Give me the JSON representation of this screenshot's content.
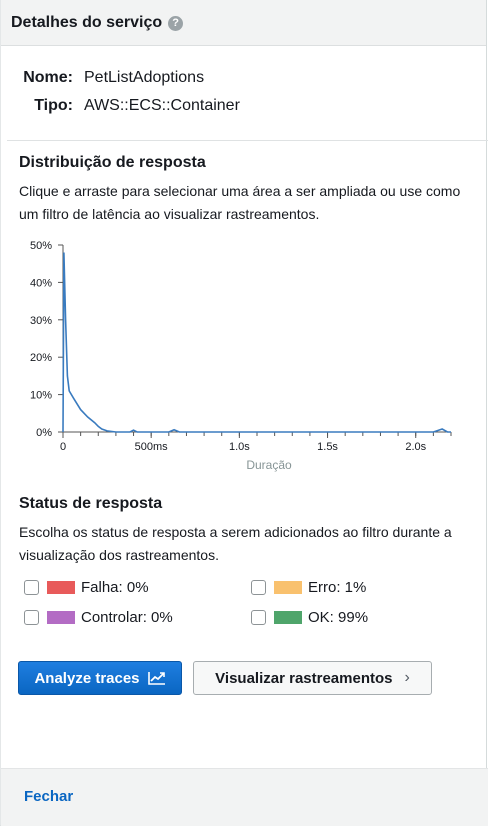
{
  "header": {
    "title": "Detalhes do serviço",
    "help_icon": "help-circle-icon"
  },
  "details": {
    "name_key": "Nome:",
    "name_value": "PetListAdoptions",
    "type_key": "Tipo:",
    "type_value": "AWS::ECS::Container"
  },
  "distribution": {
    "title": "Distribuição de resposta",
    "description": "Clique e arraste para selecionar uma área a ser ampliada ou use como um filtro de latência ao visualizar rastreamentos."
  },
  "chart_data": {
    "type": "line",
    "xlabel": "Duração",
    "ylabel": "",
    "x_ticks": [
      "0",
      "500ms",
      "1.0s",
      "1.5s",
      "2.0s"
    ],
    "y_ticks": [
      "0%",
      "10%",
      "20%",
      "30%",
      "40%",
      "50%"
    ],
    "xlim": [
      0,
      2.2
    ],
    "ylim": [
      0,
      50
    ],
    "series": [
      {
        "color": "#3a7bbf",
        "x": [
          0,
          0.005,
          0.015,
          0.025,
          0.035,
          0.06,
          0.1,
          0.14,
          0.18,
          0.2,
          0.22,
          0.25,
          0.3,
          0.38,
          0.4,
          0.42,
          0.5,
          0.6,
          0.63,
          0.66,
          0.8,
          1.0,
          1.2,
          1.4,
          1.6,
          1.8,
          2.0,
          2.1,
          2.15,
          2.18,
          2.2
        ],
        "y": [
          0,
          48,
          30,
          15,
          11,
          9,
          6,
          4,
          2.5,
          1.5,
          0.8,
          0.3,
          0,
          0,
          0.5,
          0,
          0,
          0,
          0.6,
          0,
          0,
          0,
          0,
          0,
          0,
          0,
          0,
          0,
          0.8,
          0,
          0
        ]
      }
    ]
  },
  "status": {
    "title": "Status de resposta",
    "description": "Escolha os status de resposta a serem adicionados ao filtro durante a visualização dos rastreamentos.",
    "items": [
      {
        "label": "Falha: 0%",
        "color": "#e85a5a"
      },
      {
        "label": "Erro: 1%",
        "color": "#f9c16e"
      },
      {
        "label": "Controlar: 0%",
        "color": "#b36cc4"
      },
      {
        "label": "OK: 99%",
        "color": "#4fa56b"
      }
    ]
  },
  "buttons": {
    "analyze_label": "Analyze traces",
    "analyze_icon": "chart-trend-icon",
    "view_label": "Visualizar rastreamentos",
    "view_icon": "chevron-right-icon"
  },
  "footer": {
    "close_label": "Fechar"
  }
}
